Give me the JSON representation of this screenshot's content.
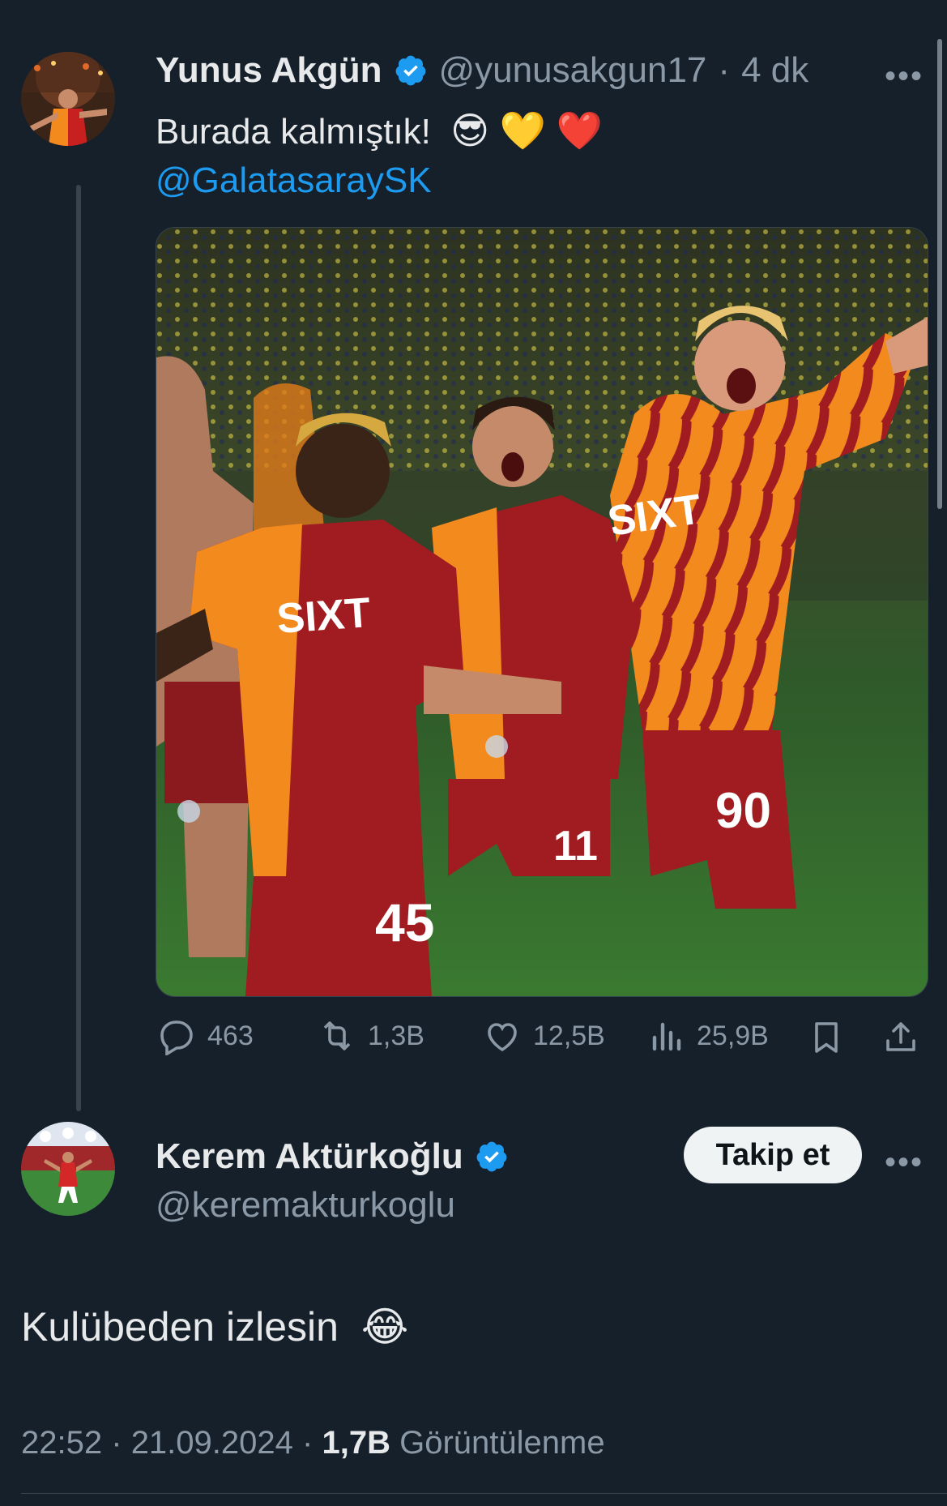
{
  "tweet1": {
    "author_name": "Yunus Akgün",
    "handle": "@yunusakgun17",
    "separator": "·",
    "time": "4 dk",
    "text": "Burada kalmıştık!",
    "emojis": "😎 💛 ❤️",
    "mention": "@GalatasaraySK",
    "more": "•••",
    "stats": {
      "replies": "463",
      "retweets": "1,3B",
      "likes": "12,5B",
      "views": "25,9B"
    }
  },
  "tweet2": {
    "author_name": "Kerem Aktürkoğlu",
    "handle": "@keremakturkoglu",
    "follow_label": "Takip et",
    "more": "•••",
    "text": "Kulübeden izlesin",
    "emoji": "😂",
    "time": "22:52",
    "date": "21.09.2024",
    "views_count": "1,7B",
    "views_label": "Görüntülenme",
    "separator": "·"
  },
  "colors": {
    "background": "#15202b",
    "accent": "#1d9bf0",
    "secondary_text": "#8b98a5",
    "primary_text": "#e7e9ea",
    "galatasaray_red": "#a01c20",
    "galatasaray_orange": "#f28a1e"
  },
  "icons": [
    "verified-badge-icon",
    "reply-icon",
    "retweet-icon",
    "like-icon",
    "views-icon",
    "bookmark-icon",
    "share-icon",
    "more-icon"
  ]
}
